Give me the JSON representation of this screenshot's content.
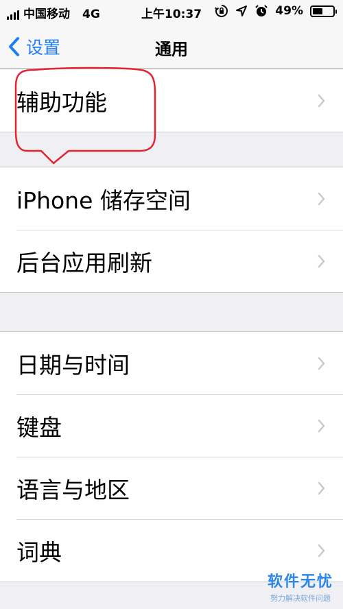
{
  "status_bar": {
    "carrier": "中国移动",
    "network": "4G",
    "time": "上午10:37",
    "battery_percent": "49%",
    "battery_level": 0.49
  },
  "nav": {
    "back_label": "设置",
    "title": "通用"
  },
  "groups": [
    {
      "items": [
        {
          "label": "辅助功能"
        }
      ]
    },
    {
      "items": [
        {
          "label": "iPhone 储存空间"
        },
        {
          "label": "后台应用刷新"
        }
      ]
    },
    {
      "items": [
        {
          "label": "日期与时间"
        },
        {
          "label": "键盘"
        },
        {
          "label": "语言与地区"
        },
        {
          "label": "词典"
        }
      ]
    }
  ],
  "colors": {
    "accent": "#1f7cf5",
    "annotation": "#e5232f",
    "background": "#efeff4"
  },
  "watermark": {
    "main": "软件无忧",
    "sub": "努力解决软件问题"
  }
}
